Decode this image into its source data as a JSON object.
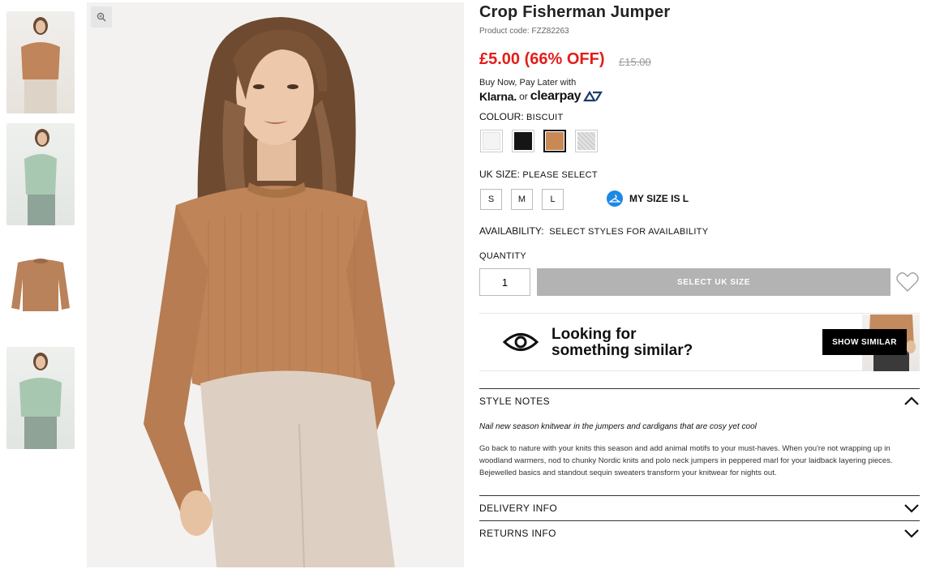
{
  "product": {
    "title": "Crop Fisherman Jumper",
    "code": "Product code: FZZ82263",
    "price": "£5.00 (66% OFF)",
    "old_price": "£15.00",
    "bnpl_text": "Buy Now, Pay Later with",
    "klarna": "Klarna.",
    "or": "or",
    "clearpay": "clearpay"
  },
  "colour": {
    "label": "COLOUR:",
    "value": "BISCUIT",
    "swatches": [
      {
        "name": "white",
        "color": "#f4f4f4"
      },
      {
        "name": "black",
        "color": "#151515"
      },
      {
        "name": "biscuit",
        "color": "#c88954"
      },
      {
        "name": "grey-marl",
        "color": "#dcdcdc"
      }
    ]
  },
  "size": {
    "label": "UK SIZE:",
    "value": "PLEASE SELECT",
    "options": [
      "S",
      "M",
      "L"
    ],
    "my_size": "MY SIZE IS L"
  },
  "availability": {
    "label": "AVAILABILITY:",
    "value": "SELECT STYLES FOR AVAILABILITY"
  },
  "quantity": {
    "label": "QUANTITY",
    "value": "1"
  },
  "cta": {
    "select_size": "SELECT UK SIZE"
  },
  "similar": {
    "line1": "Looking for",
    "line2": "something similar?",
    "button": "SHOW SIMILAR"
  },
  "style_notes": {
    "title": "STYLE NOTES",
    "subtitle": "Nail new season knitwear in the jumpers and cardigans that are cosy yet cool",
    "body": "Go back to nature with your knits this season and add animal motifs to your must-haves. When you're not wrapping up in woodland warmers, nod to chunky Nordic knits and polo neck jumpers in peppered marl for your laidback layering pieces. Bejewelled basics and standout sequin sweaters transform your knitwear for nights out."
  },
  "accordions": {
    "delivery": "DELIVERY INFO",
    "returns": "RETURNS INFO"
  },
  "colors": {
    "price_red": "#e31d1a",
    "jumper": "#bf8458",
    "button_grey": "#b3b3b3",
    "size_blue": "#1e88e5"
  }
}
